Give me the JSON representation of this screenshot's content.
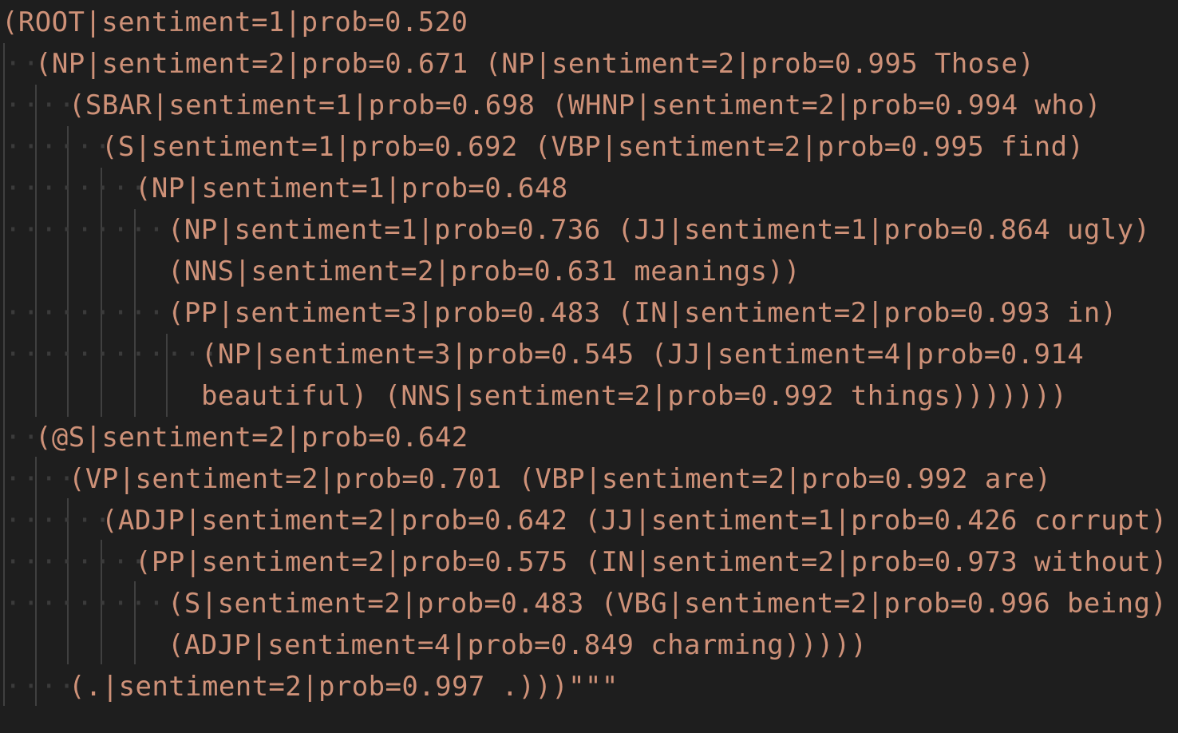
{
  "editor": {
    "colors": {
      "background": "#1e1e1e",
      "string": "#ce9178",
      "indent_guide": "#404040",
      "whitespace_dot": "#3b3b3b"
    },
    "lines": [
      {
        "text": "(ROOT|sentiment=1|prob=0.520"
      },
      {
        "text": "(NP|sentiment=2|prob=0.671 (NP|sentiment=2|prob=0.995 Those)"
      },
      {
        "text": "(SBAR|sentiment=1|prob=0.698 (WHNP|sentiment=2|prob=0.994 who)"
      },
      {
        "text": "(S|sentiment=1|prob=0.692 (VBP|sentiment=2|prob=0.995 find)"
      },
      {
        "text": "(NP|sentiment=1|prob=0.648"
      },
      {
        "text": "(NP|sentiment=1|prob=0.736 (JJ|sentiment=1|prob=0.864 ugly)"
      },
      {
        "text": "(NNS|sentiment=2|prob=0.631 meanings))"
      },
      {
        "text": "(PP|sentiment=3|prob=0.483 (IN|sentiment=2|prob=0.993 in)"
      },
      {
        "text": "(NP|sentiment=3|prob=0.545 (JJ|sentiment=4|prob=0.914"
      },
      {
        "text": "beautiful) (NNS|sentiment=2|prob=0.992 things)))))))"
      },
      {
        "text": "(@S|sentiment=2|prob=0.642"
      },
      {
        "text": "(VP|sentiment=2|prob=0.701 (VBP|sentiment=2|prob=0.992 are)"
      },
      {
        "text": "(ADJP|sentiment=2|prob=0.642 (JJ|sentiment=1|prob=0.426 corrupt)"
      },
      {
        "text": "(PP|sentiment=2|prob=0.575 (IN|sentiment=2|prob=0.973 without)"
      },
      {
        "text": "(S|sentiment=2|prob=0.483 (VBG|sentiment=2|prob=0.996 being)"
      },
      {
        "text": "(ADJP|sentiment=4|prob=0.849 charming)))))"
      },
      {
        "text": "(.|sentiment=2|prob=0.997 .)))\"\"\""
      }
    ]
  }
}
